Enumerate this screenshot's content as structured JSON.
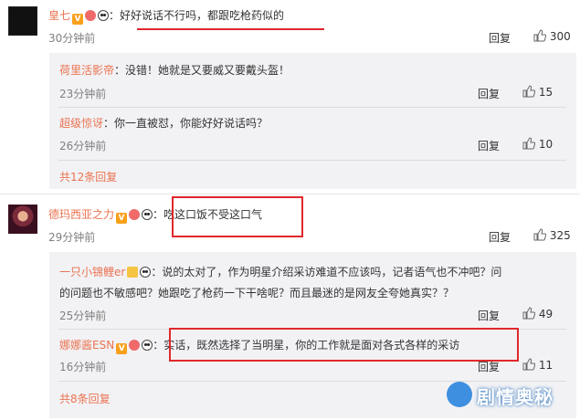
{
  "comments": [
    {
      "user": "皇七",
      "text": "：好好说话不行吗，都跟吃枪药似的",
      "time": "30分钟前",
      "reply_label": "回复",
      "likes": "300",
      "replies": [
        {
          "user": "荷里活影帝",
          "text": "：没错！她就是又要威又要戴头盔！",
          "time": "23分钟前",
          "reply_label": "回复",
          "likes": "15"
        },
        {
          "user": "超级惊讶",
          "text": "：你一直被怼，你能好好说话吗？",
          "time": "26分钟前",
          "reply_label": "回复",
          "likes": "10"
        }
      ],
      "more_replies": "共12条回复"
    },
    {
      "user": "德玛西亚之力",
      "text": "：吃这口饭不受这口气",
      "time": "29分钟前",
      "reply_label": "回复",
      "likes": "325",
      "replies": [
        {
          "user": "一只小锦鲤er",
          "text": "：说的太对了，作为明星介绍采访难道不应该吗，记者语气也不冲吧？问",
          "text2": "的问题也不敏感吧？她跟吃了枪药一下干啥呢？而且最迷的是网友全夸她真实？？",
          "time": "25分钟前",
          "reply_label": "回复",
          "likes": "49"
        },
        {
          "user": "娜娜酱ESN",
          "text": "：实话，既然选择了当明星，你的工作就是面对各式各样的采访",
          "time": "16分钟前",
          "reply_label": "回复",
          "likes": "11"
        }
      ],
      "more_replies": "共8条回复"
    }
  ],
  "badges": {
    "v": "V"
  },
  "watermark": {
    "text": "剧情奥秘"
  },
  "colors": {
    "username": "#eb7350",
    "highlight": "#e0282c",
    "reply_bg": "#f2f2f5"
  },
  "icons": [
    "verified-icon",
    "crown-icon",
    "heart-badge-icon",
    "panda-icon",
    "thumb-up-icon"
  ]
}
